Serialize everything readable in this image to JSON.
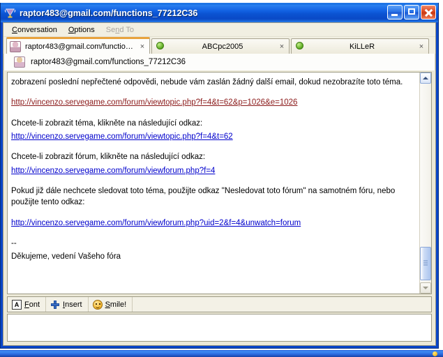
{
  "window": {
    "title": "raptor483@gmail.com/functions_77212C36",
    "app_icon": "gaim-logo-icon",
    "caption": {
      "minimize": "minimize-button",
      "maximize": "maximize-button",
      "close": "close-button"
    },
    "colors": {
      "titlebar_blue": "#0b53d2",
      "frame_blue": "#0a46c8",
      "client_beige": "#ece9d8",
      "active_tab_accent": "#e8a33d",
      "link_blue": "#0000cc",
      "link_visited": "#8b1a1a",
      "status_online_green": "#5aa81f"
    }
  },
  "menubar": {
    "items": [
      {
        "label": "Conversation",
        "accel": "C",
        "disabled": false
      },
      {
        "label": "Options",
        "accel": "O",
        "disabled": false
      },
      {
        "label": "Send To",
        "accel": "n",
        "disabled": true
      }
    ]
  },
  "tabs": [
    {
      "label": "raptor483@gmail.com/functions...",
      "icon": "person-icon",
      "active": true,
      "close_label": "×"
    },
    {
      "label": "ABCpc2005",
      "icon": "status-online-icon",
      "active": false,
      "close_label": "×"
    },
    {
      "label": "KiLLeR",
      "icon": "status-online-icon",
      "active": false,
      "close_label": "×"
    }
  ],
  "conversation": {
    "contact_name": "raptor483@gmail.com/functions_77212C36",
    "avatar": "contact-avatar-icon",
    "message": {
      "line1": "zobrazení poslední nepřečtené odpovědi, nebude vám zaslán žádný další email, dokud nezobrazíte toto téma.",
      "link1": "http://vincenzo.servegame.com/forum/viewtopic.php?f=4&t=62&p=1026&e=1026",
      "line2": "Chcete-li zobrazit téma, klikněte na následující odkaz:",
      "link2": "http://vincenzo.servegame.com/forum/viewtopic.php?f=4&t=62",
      "line3": "Chcete-li zobrazit fórum, klikněte na následující odkaz:",
      "link3": "http://vincenzo.servegame.com/forum/viewforum.php?f=4",
      "line4": "Pokud již dále nechcete sledovat toto téma, použijte odkaz \"Nesledovat toto fórum\" na samotném fóru, nebo použijte tento odkaz:",
      "link4": "http://vincenzo.servegame.com/forum/viewforum.php?uid=2&f=4&unwatch=forum",
      "line5": "--",
      "line6": "Děkujeme, vedení Vašeho fóra"
    }
  },
  "scrollbar": {
    "up_arrow": "scroll-up-arrow-icon",
    "down_arrow": "scroll-down-arrow-icon"
  },
  "format_toolbar": {
    "buttons": [
      {
        "label": "Font",
        "accel": "F",
        "icon": "font-a-icon",
        "glyph": "A"
      },
      {
        "label": "Insert",
        "accel": "I",
        "icon": "plus-icon"
      },
      {
        "label": "Smile!",
        "accel": "S",
        "icon": "smiley-icon"
      }
    ]
  },
  "input": {
    "value": "",
    "placeholder": ""
  }
}
